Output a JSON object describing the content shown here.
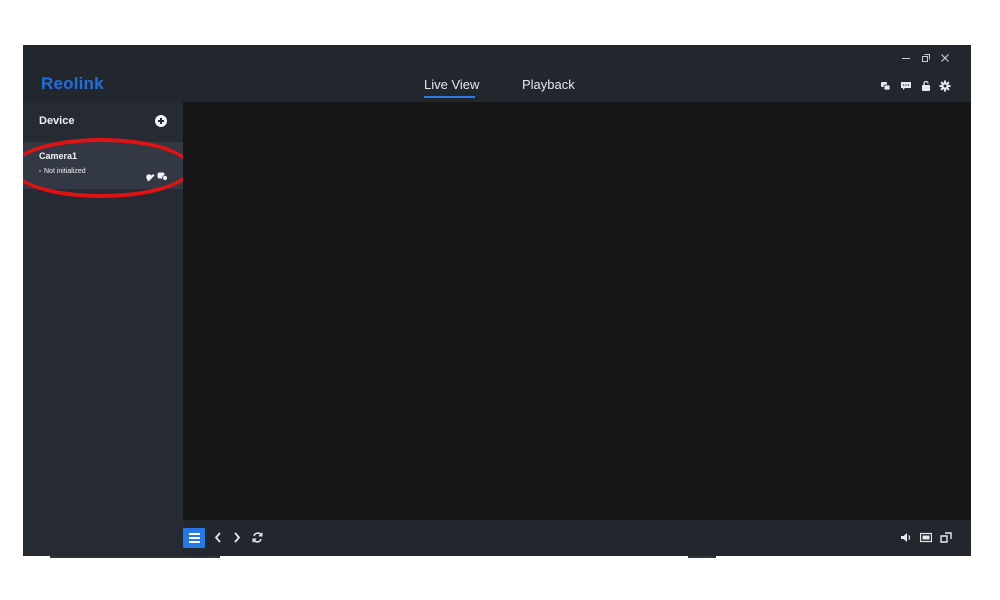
{
  "app": {
    "logo": "Reolink",
    "window_controls": {
      "minimize_icon": "minimize-icon",
      "restore_icon": "restore-icon",
      "close_icon": "close-icon"
    },
    "tabs": [
      {
        "label": "Live View",
        "active": true
      },
      {
        "label": "Playback",
        "active": false
      }
    ],
    "header_icons": [
      "messages-icon",
      "chat-icon",
      "lock-icon",
      "gear-icon"
    ]
  },
  "sidebar": {
    "title": "Device",
    "add_icon": "add-device-icon",
    "devices": [
      {
        "name": "Camera1",
        "status": "Not initialized"
      }
    ]
  },
  "toolbar": {
    "left_icons": [
      "list-view-icon",
      "previous-icon",
      "next-icon",
      "refresh-icon"
    ],
    "right_icons": [
      "volume-icon",
      "aspect-ratio-icon",
      "fullscreen-icon"
    ]
  },
  "colors": {
    "brand": "#1f6fe0",
    "accent": "#2b7bea",
    "annotation": "#e11212",
    "background": "#22262d",
    "video": "#161616"
  }
}
